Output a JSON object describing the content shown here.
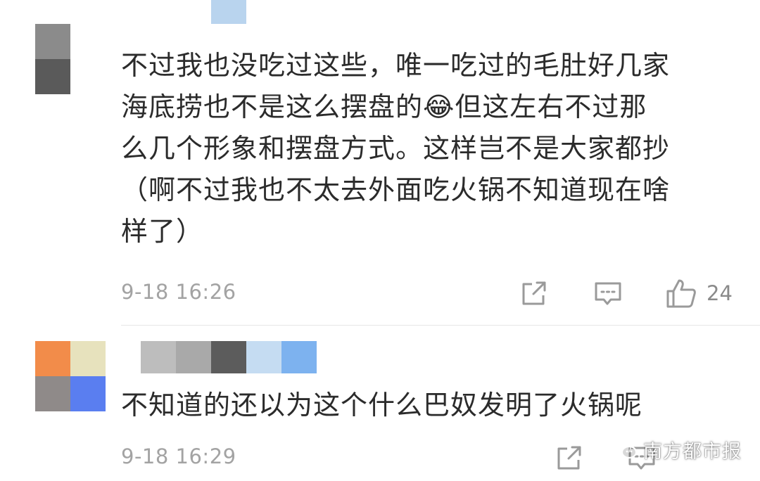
{
  "comments": [
    {
      "lines": [
        "不过我也没吃过这些，唯一吃过的毛肚好几家",
        "海底捞也不是这么摆盘的😂但这左右不过那",
        "么几个形象和摆盘方式。这样岂不是大家都抄",
        "（啊不过我也不太去外面吃火锅不知道现在啥",
        "样了）"
      ],
      "timestamp": "9-18 16:26",
      "likes": "24",
      "avatar_colors": [
        "#8a2323",
        "#c77b82",
        "#5a5a5a",
        "#ffffff"
      ],
      "username_colors": [
        "#ffffff",
        "#ffffff",
        "#b9d4ee",
        "#ffffff",
        "#ffffff"
      ]
    },
    {
      "lines": [
        "不知道的还以为这个什么巴奴发明了火锅呢"
      ],
      "timestamp": "9-18 16:29",
      "avatar_colors": [
        "#f28c4a",
        "#e7e2bd",
        "#8f8a89",
        "#5a7ef0"
      ],
      "username_colors": [
        "#bdbdbd",
        "#a9a9a9",
        "#5c5c5c",
        "#c5dcf2",
        "#7db2ef"
      ]
    }
  ],
  "icons": {
    "share": "share-icon",
    "reply": "comment-icon",
    "like": "thumbs-up-icon",
    "watermark": "wechat-icon"
  },
  "watermark": {
    "text": "南方都市报"
  }
}
